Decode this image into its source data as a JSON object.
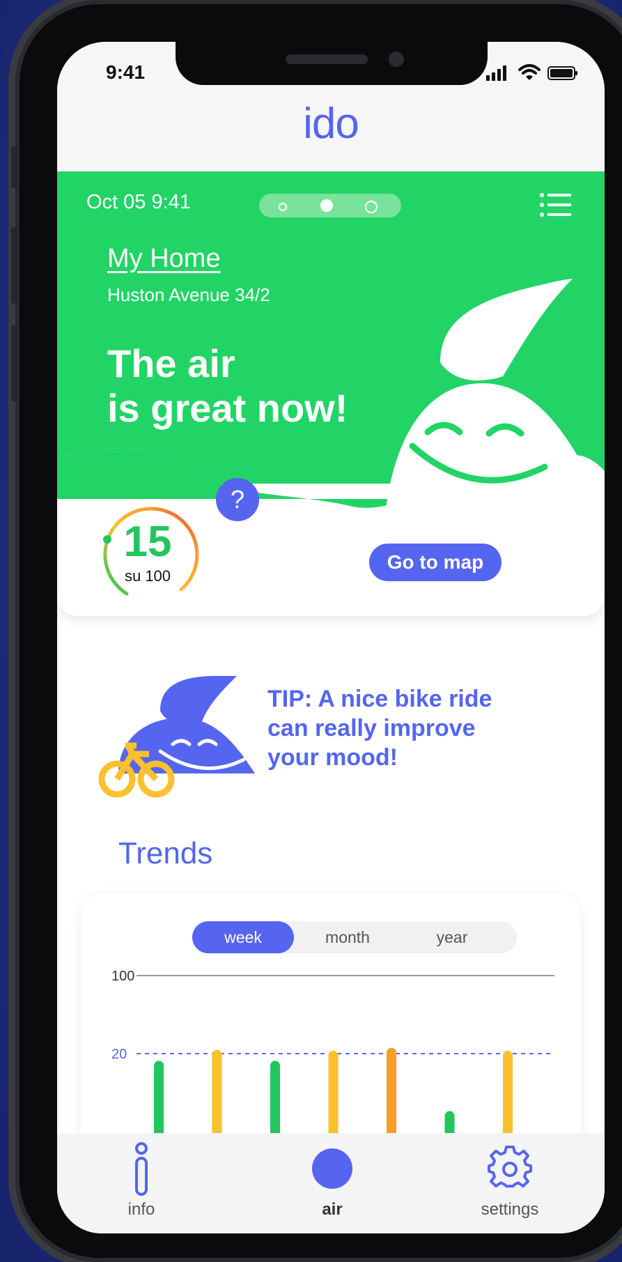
{
  "status_bar": {
    "time": "9:41"
  },
  "app": {
    "logo": "ido"
  },
  "hero": {
    "datetime": "Oct 05  9:41",
    "page_dots": {
      "count": 3,
      "active_index": 1
    },
    "location_name": "My Home",
    "address": "Huston Avenue 34/2",
    "headline_line1": "The air",
    "headline_line2": "is great now!",
    "colors": {
      "background": "#22d466",
      "text": "#ffffff"
    }
  },
  "air_quality": {
    "value": "15",
    "scale_label": "su 100",
    "value_numeric": 15,
    "max": 100,
    "help_label": "?",
    "map_button_label": "Go to map"
  },
  "tip": {
    "text": "TIP: A nice bike ride can really improve your mood!"
  },
  "trends": {
    "title": "Trends",
    "tabs": [
      {
        "label": "week",
        "active": true
      },
      {
        "label": "month",
        "active": false
      },
      {
        "label": "year",
        "active": false
      }
    ]
  },
  "chart_data": {
    "type": "bar",
    "categories": [
      "",
      "",
      "",
      "",
      "",
      "",
      ""
    ],
    "values": [
      19,
      24,
      19,
      23,
      26,
      12,
      23
    ],
    "colors": [
      "#22c55e",
      "#fbc02d",
      "#22c55e",
      "#fbc02d",
      "#f59e2b",
      "#22c55e",
      "#fbc02d"
    ],
    "yticks": [
      "100",
      "20"
    ],
    "ytick_values": [
      100,
      20
    ],
    "threshold": 20,
    "threshold_style": "dashed",
    "title": "",
    "xlabel": "",
    "ylabel": ""
  },
  "nav": {
    "items": [
      {
        "label": "info",
        "icon": "info-icon",
        "active": false
      },
      {
        "label": "air",
        "icon": "air-dot-icon",
        "active": true
      },
      {
        "label": "settings",
        "icon": "gear-icon",
        "active": false
      }
    ]
  },
  "colors": {
    "accent": "#5565f0",
    "green": "#22d466",
    "yellow": "#fbc02d",
    "orange": "#f59e2b"
  }
}
